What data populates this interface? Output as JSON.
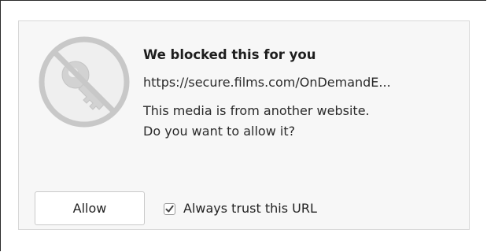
{
  "dialog": {
    "icon": "blocked-key-icon",
    "title": "We blocked this for you",
    "url": "https://secure.films.com/OnDemandE...",
    "message_line1": "This media is from another website.",
    "message_line2": "Do you want to allow it?",
    "allow_label": "Allow",
    "trust_label": "Always trust this URL",
    "trust_checked": true
  },
  "colors": {
    "dialog_background": "#f7f7f7",
    "dialog_border": "#d8d8d8",
    "icon_gray": "#c8c8c8",
    "text": "#222222"
  }
}
